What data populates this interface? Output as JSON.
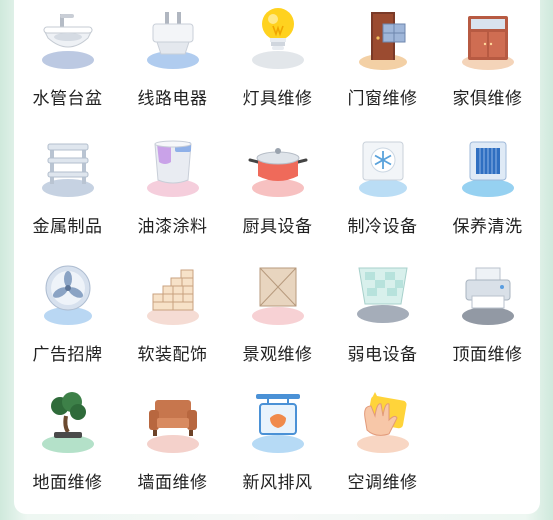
{
  "services": [
    {
      "label": "水管台盆",
      "icon": "washbasin-icon"
    },
    {
      "label": "线路电器",
      "icon": "plug-icon"
    },
    {
      "label": "灯具维修",
      "icon": "lightbulb-icon"
    },
    {
      "label": "门窗维修",
      "icon": "door-window-icon"
    },
    {
      "label": "家俱维修",
      "icon": "cabinet-icon"
    },
    {
      "label": "金属制品",
      "icon": "metal-shelf-icon"
    },
    {
      "label": "油漆涂料",
      "icon": "paint-bucket-icon"
    },
    {
      "label": "厨具设备",
      "icon": "cooking-pot-icon"
    },
    {
      "label": "制冷设备",
      "icon": "snowflake-icon"
    },
    {
      "label": "保养清洗",
      "icon": "filter-screen-icon"
    },
    {
      "label": "广告招牌",
      "icon": "fan-icon"
    },
    {
      "label": "软装配饰",
      "icon": "brick-wall-icon"
    },
    {
      "label": "景观维修",
      "icon": "tile-icon"
    },
    {
      "label": "弱电设备",
      "icon": "glass-panel-icon"
    },
    {
      "label": "顶面维修",
      "icon": "printer-icon"
    },
    {
      "label": "地面维修",
      "icon": "bonsai-icon"
    },
    {
      "label": "墙面维修",
      "icon": "sofa-icon"
    },
    {
      "label": "新风排风",
      "icon": "signboard-icon"
    },
    {
      "label": "空调维修",
      "icon": "cleaning-glove-icon"
    }
  ]
}
